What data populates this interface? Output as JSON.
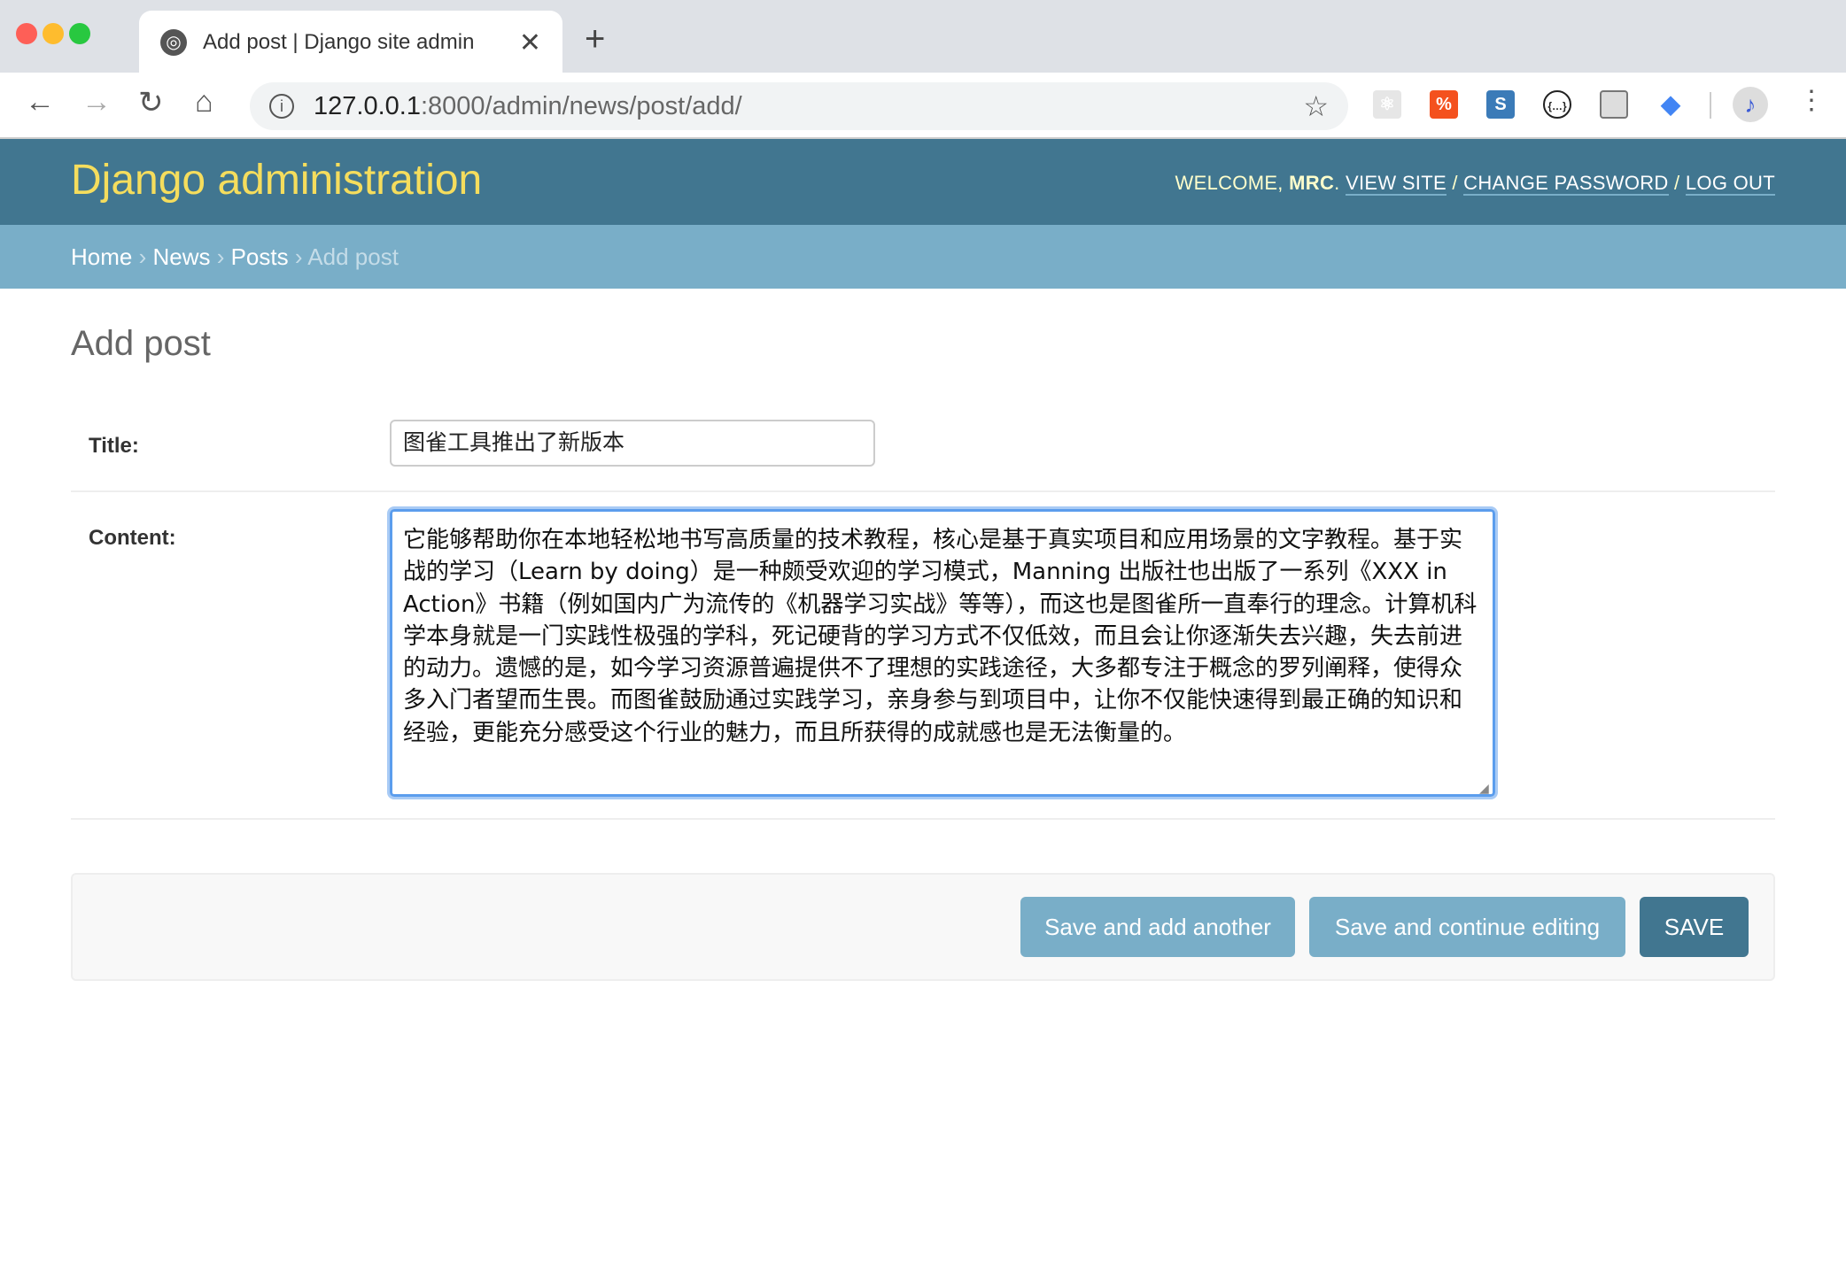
{
  "browser": {
    "tab_title": "Add post | Django site admin",
    "url_host": "127.0.0.1",
    "url_path": ":8000/admin/news/post/add/",
    "new_tab": "+",
    "close": "✕"
  },
  "header": {
    "brand": "Django administration",
    "welcome": "WELCOME, ",
    "user": "MRC",
    "dot": ". ",
    "view_site": "VIEW SITE",
    "change_password": "CHANGE PASSWORD",
    "log_out": "LOG OUT",
    "sep": " / "
  },
  "breadcrumbs": {
    "home": "Home",
    "news": "News",
    "posts": "Posts",
    "current": "Add post",
    "sep": " › "
  },
  "page": {
    "title": "Add post"
  },
  "form": {
    "title_label": "Title:",
    "title_value": "图雀工具推出了新版本",
    "content_label": "Content:",
    "content_value": "它能够帮助你在本地轻松地书写高质量的技术教程，核心是基于真实项目和应用场景的文字教程。基于实战的学习（Learn by doing）是一种颇受欢迎的学习模式，Manning 出版社也出版了一系列《XXX in Action》书籍（例如国内广为流传的《机器学习实战》等等），而这也是图雀所一直奉行的理念。计算机科学本身就是一门实践性极强的学科，死记硬背的学习方式不仅低效，而且会让你逐渐失去兴趣，失去前进的动力。遗憾的是，如今学习资源普遍提供不了理想的实践途径，大多都专注于概念的罗列阐释，使得众多入门者望而生畏。而图雀鼓励通过实践学习，亲身参与到项目中，让你不仅能快速得到最正确的知识和经验，更能充分感受这个行业的魅力，而且所获得的成就感也是无法衡量的。"
  },
  "actions": {
    "save_add_another": "Save and add another",
    "save_continue": "Save and continue editing",
    "save": "SAVE"
  },
  "colors": {
    "header": "#417690",
    "breadcrumbs": "#79aec8",
    "brand": "#f5dd5d",
    "button": "#79aec8",
    "default_button": "#417690"
  }
}
